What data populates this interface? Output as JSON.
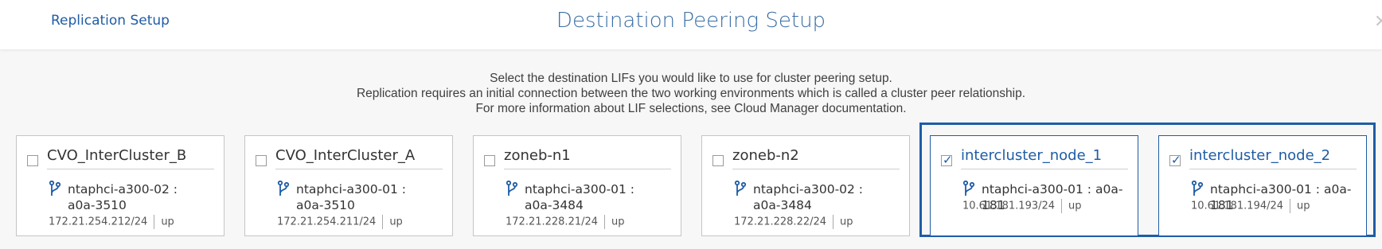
{
  "header": {
    "breadcrumb": "Replication Setup",
    "title": "Destination Peering Setup",
    "close_symbol": "✕"
  },
  "intro": {
    "line1": "Select the destination LIFs you would like to use for cluster peering setup.",
    "line2": "Replication requires an initial connection between the two working environments which is called a cluster peer relationship.",
    "line3": "For more information about LIF selections, see Cloud Manager documentation."
  },
  "lifs": [
    {
      "name": "CVO_InterCluster_B",
      "node_line1": "ntaphci-a300-02 :",
      "node_line2": "a0a-3510",
      "ip": "172.21.254.212/24",
      "status": "up",
      "checked": false
    },
    {
      "name": "CVO_InterCluster_A",
      "node_line1": "ntaphci-a300-01 :",
      "node_line2": "a0a-3510",
      "ip": "172.21.254.211/24",
      "status": "up",
      "checked": false
    },
    {
      "name": "zoneb-n1",
      "node_line1": "ntaphci-a300-01 :",
      "node_line2": "a0a-3484",
      "ip": "172.21.228.21/24",
      "status": "up",
      "checked": false
    },
    {
      "name": "zoneb-n2",
      "node_line1": "ntaphci-a300-02 :",
      "node_line2": "a0a-3484",
      "ip": "172.21.228.22/24",
      "status": "up",
      "checked": false
    },
    {
      "name": "intercluster_node_1",
      "node_line1": "ntaphci-a300-01 : a0a-181",
      "node_line2": "",
      "ip": "10.61.181.193/24",
      "status": "up",
      "checked": true
    },
    {
      "name": "intercluster_node_2",
      "node_line1": "ntaphci-a300-01 : a0a-181",
      "node_line2": "",
      "ip": "10.61.181.194/24",
      "status": "up",
      "checked": true
    }
  ],
  "icons": {
    "lif": "network-fork-icon",
    "checkbox_tick": "✓"
  },
  "colors": {
    "accent": "#1f5ca6",
    "border": "#c5c5c5",
    "background": "#f7f7f7"
  }
}
